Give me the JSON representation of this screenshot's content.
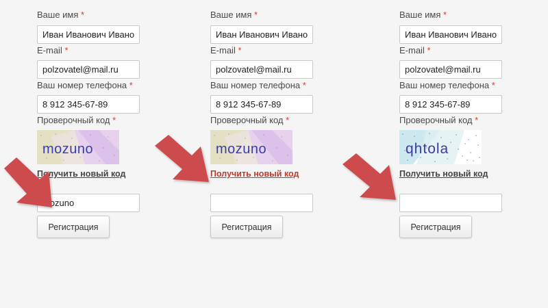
{
  "labels": {
    "name": "Ваше имя",
    "email": "E-mail",
    "phone": "Ваш номер телефона",
    "captcha": "Проверочный код",
    "required_mark": "*"
  },
  "new_code_link": "Получить новый код",
  "register_button": "Регистрация",
  "forms": [
    {
      "name_value": "Иван Иванович Иванов",
      "email_value": "polzovatel@mail.ru",
      "phone_value": "8 912 345-67-89",
      "captcha_text": "mozuno",
      "captcha_input_value": "mozuno",
      "link_state": "normal"
    },
    {
      "name_value": "Иван Иванович Иванов",
      "email_value": "polzovatel@mail.ru",
      "phone_value": "8 912 345-67-89",
      "captcha_text": "mozuno",
      "captcha_input_value": "",
      "link_state": "hover"
    },
    {
      "name_value": "Иван Иванович Иванов",
      "email_value": "polzovatel@mail.ru",
      "phone_value": "8 912 345-67-89",
      "captcha_text": "qhtola",
      "captcha_input_value": "",
      "link_state": "normal"
    }
  ],
  "colors": {
    "required": "#d9393c",
    "link_active": "#c0392b",
    "arrow": "#cd4b4e"
  },
  "icons": {
    "pointer_arrow": "arrow-down-right-icon"
  }
}
